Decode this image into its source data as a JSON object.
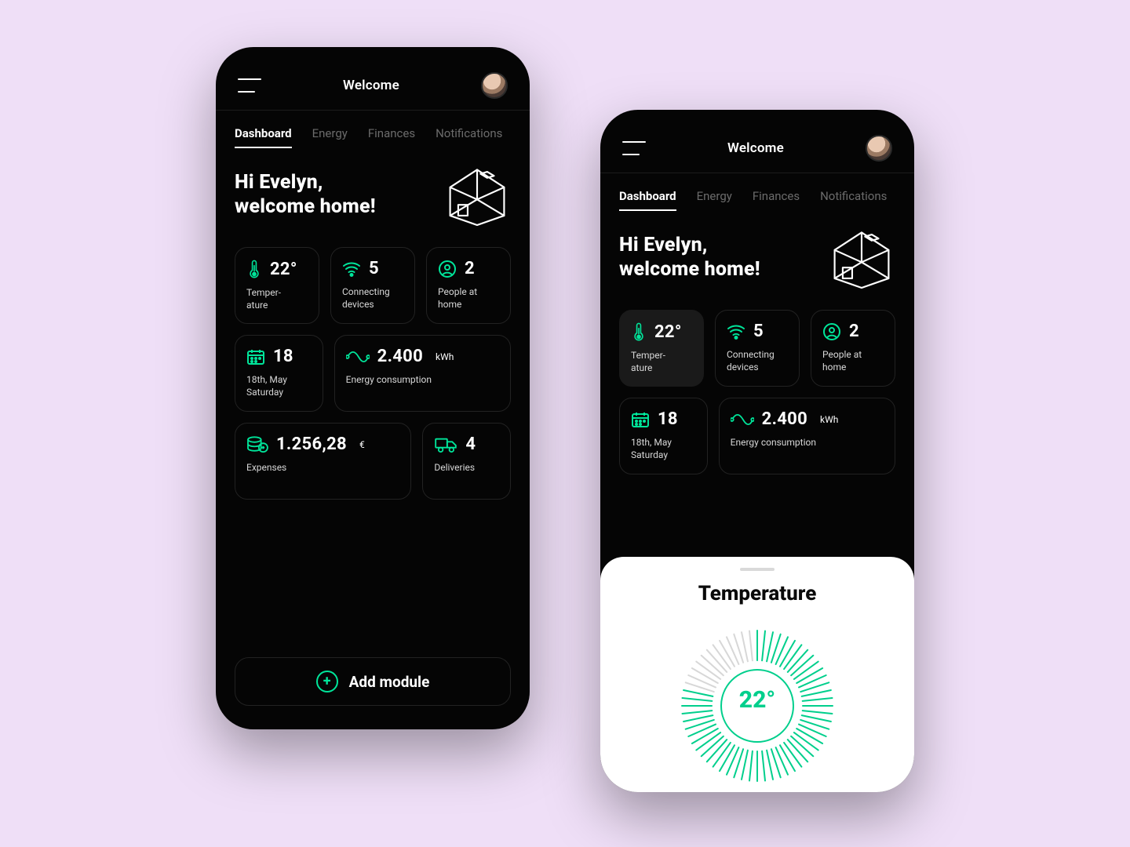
{
  "colors": {
    "accent": "#00e59a",
    "bg": "#050505",
    "page": "#efdff7"
  },
  "header": {
    "title": "Welcome"
  },
  "tabs": [
    "Dashboard",
    "Energy",
    "Finances",
    "Notifications"
  ],
  "activeTab": "Dashboard",
  "greeting": {
    "line1": "Hi Evelyn,",
    "line2": "welcome home!"
  },
  "modules": {
    "temperature": {
      "value": "22°",
      "label": "Temper-\nature"
    },
    "devices": {
      "value": "5",
      "label": "Connecting devices"
    },
    "people": {
      "value": "2",
      "label": "People at home"
    },
    "date": {
      "value": "18",
      "label": "18th, May\nSaturday"
    },
    "energy": {
      "value": "2.400",
      "unit": "kWh",
      "label": "Energy consumption"
    },
    "expenses": {
      "value": "1.256,28",
      "unit": "€",
      "label": "Expenses"
    },
    "deliveries": {
      "value": "4",
      "label": "Deliveries"
    }
  },
  "addModule": {
    "label": "Add module"
  },
  "sheet": {
    "title": "Temperature",
    "value": "22°"
  }
}
